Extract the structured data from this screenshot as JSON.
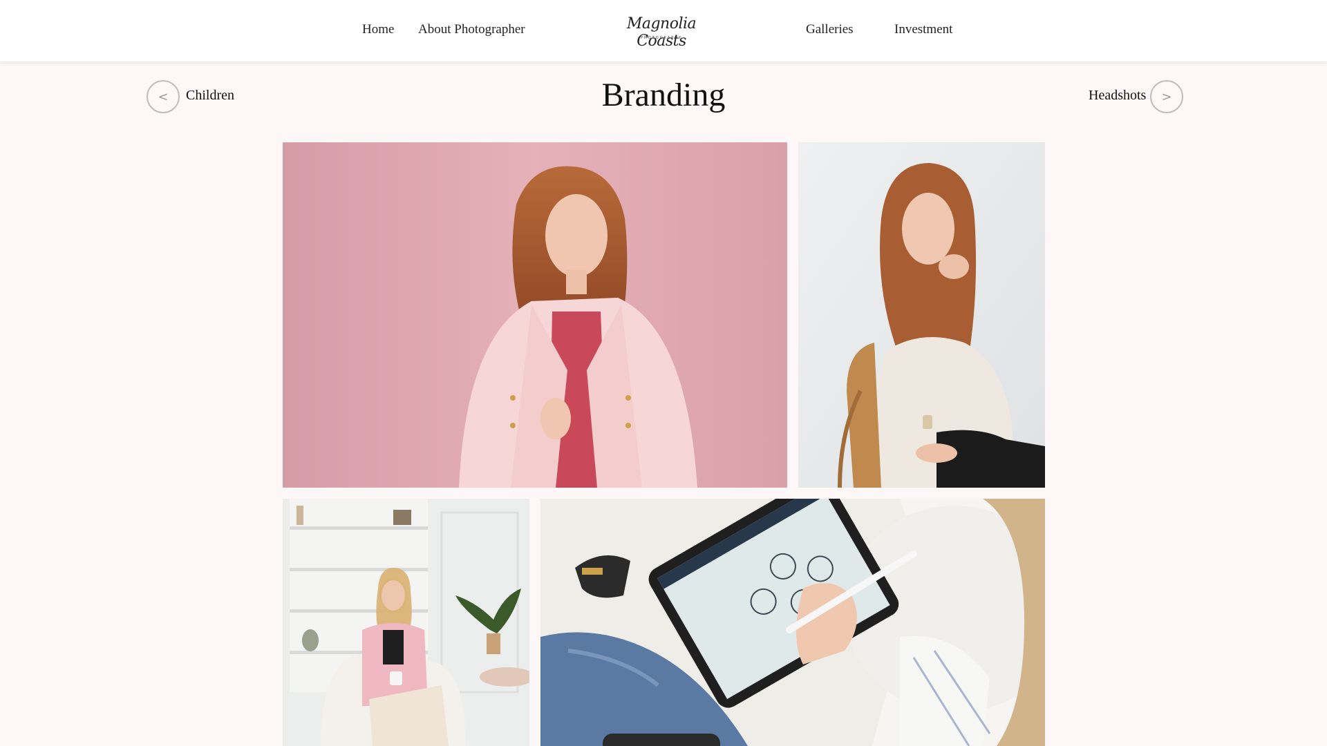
{
  "nav": {
    "home": "Home",
    "about": "About Photographer",
    "galleries": "Galleries",
    "investment": "Investment"
  },
  "logo": {
    "script": "Magnolia Coasts",
    "sub": "PHOTOGRAPHY"
  },
  "gallery": {
    "title": "Branding",
    "prev_label": "Children",
    "prev_icon": "<",
    "next_label": "Headshots",
    "next_icon": ">"
  },
  "photos": [
    {
      "subject": "woman-pink-blazer-pink-backdrop"
    },
    {
      "subject": "woman-seated-rattan-chair"
    },
    {
      "subject": "woman-armchair-white-room"
    },
    {
      "subject": "hands-tablet-stylus"
    }
  ],
  "colors": {
    "background": "#fdf8f7",
    "header": "#ffffff",
    "accent_pink": "#e4aeb6"
  }
}
